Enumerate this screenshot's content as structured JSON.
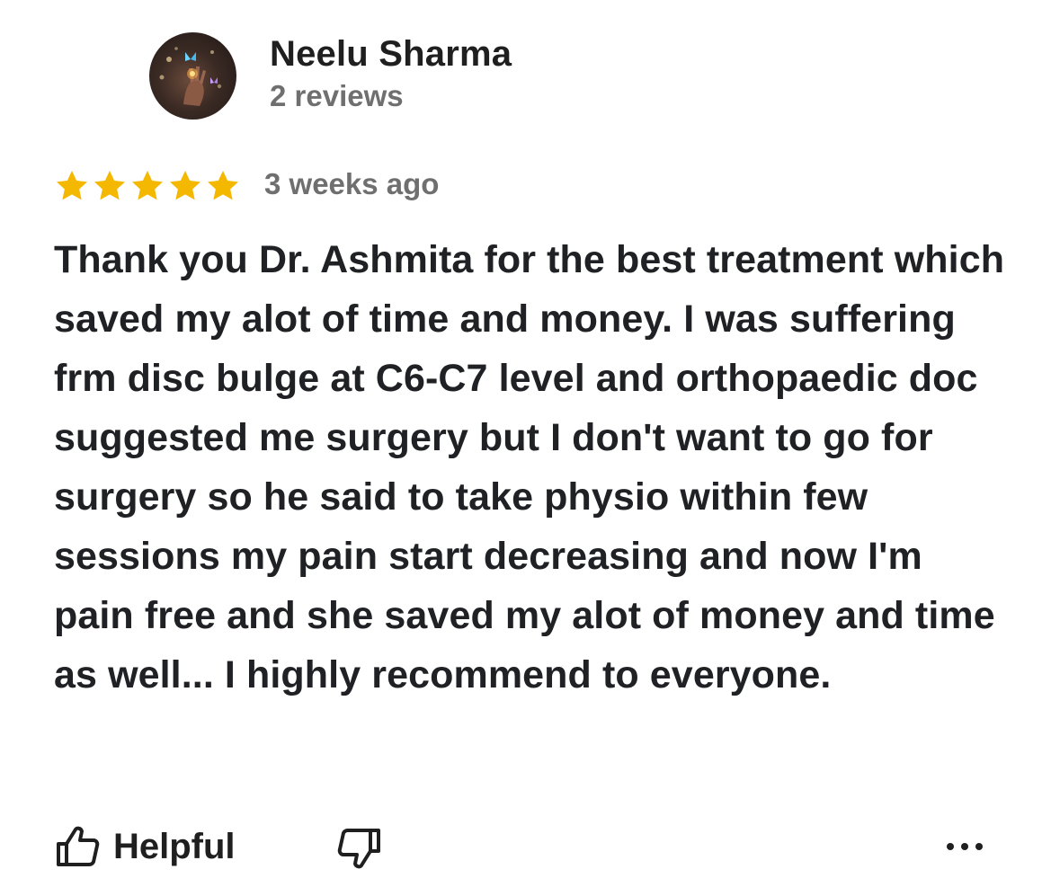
{
  "review": {
    "author": {
      "name": "Neelu Sharma",
      "review_count": "2 reviews"
    },
    "rating": 5,
    "rating_max": 5,
    "date": "3 weeks ago",
    "text": "Thank you Dr. Ashmita for the best treatment which saved my alot of time and money. I was suffering frm disc bulge at C6-C7 level and orthopaedic doc suggested me surgery but I don't want to go for surgery so he said to take physio within few sessions my pain start decreasing and now I'm pain free and she saved my alot of money and time as well... I highly recommend to everyone."
  },
  "actions": {
    "helpful_label": "Helpful",
    "helpful_icon": "thumbs-up-icon",
    "dislike_icon": "thumbs-down-icon",
    "more_icon": "more-horizontal-icon"
  },
  "colors": {
    "star": "#f5b800",
    "text_primary": "#1f1f1f",
    "text_secondary": "#6f6f6f",
    "background": "#ffffff"
  }
}
